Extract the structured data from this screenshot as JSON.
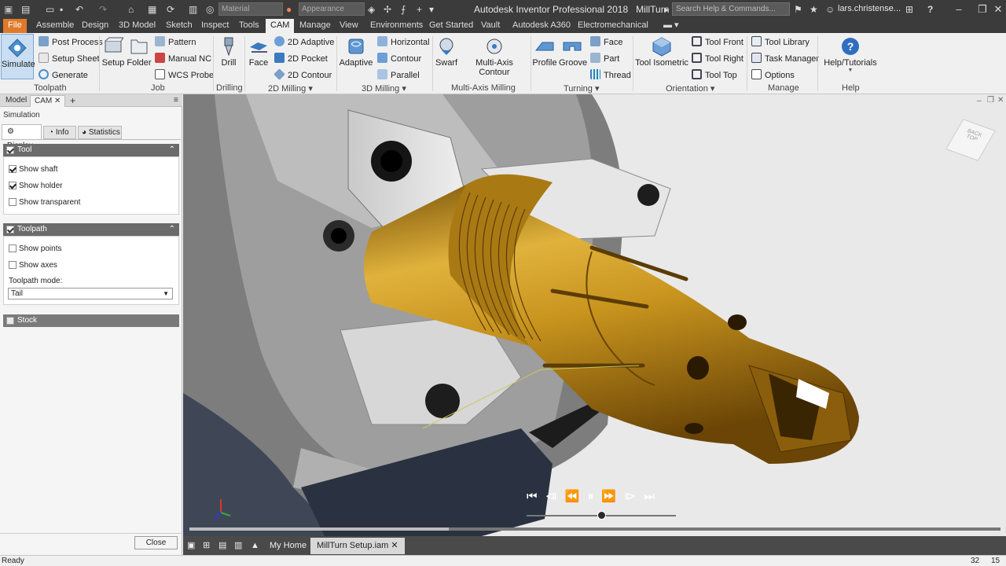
{
  "title_bar": {
    "app_title": "Autodesk Inventor Professional 2018",
    "document_name": "MillTurn Setup.iam",
    "material_dropdown": "Material",
    "appearance_dropdown": "Appearance",
    "search_placeholder": "Search Help & Commands...",
    "user_name": "lars.christense...",
    "help_label": "?"
  },
  "menu_tabs": [
    "File",
    "Assemble",
    "Design",
    "3D Model",
    "Sketch",
    "Inspect",
    "Tools",
    "CAM",
    "Manage",
    "View",
    "Environments",
    "Get Started",
    "Vault",
    "Autodesk A360",
    "Electromechanical"
  ],
  "active_tab": "CAM",
  "ribbon": {
    "toolpath": {
      "group": "Toolpath",
      "simulate": "Simulate",
      "post_process": "Post Process",
      "setup_sheet": "Setup Sheet",
      "generate": "Generate"
    },
    "job": {
      "group": "Job",
      "setup": "Setup",
      "folder": "Folder",
      "pattern": "Pattern",
      "manual_nc": "Manual NC",
      "wcs_probe": "WCS Probe"
    },
    "drilling": {
      "group": "Drilling",
      "drill": "Drill"
    },
    "milling_2d": {
      "group": "2D Milling",
      "face": "Face",
      "adaptive_2d": "2D Adaptive",
      "pocket_2d": "2D Pocket",
      "contour_2d": "2D Contour"
    },
    "milling_3d": {
      "group": "3D Milling",
      "adaptive": "Adaptive",
      "horizontal": "Horizontal",
      "contour": "Contour",
      "parallel": "Parallel"
    },
    "multi_axis": {
      "group": "Multi-Axis Milling",
      "swarf": "Swarf",
      "multi_axis_contour": "Multi-Axis Contour"
    },
    "turning": {
      "group": "Turning",
      "profile": "Profile",
      "groove": "Groove",
      "face": "Face",
      "part": "Part",
      "thread": "Thread"
    },
    "orientation": {
      "group": "Orientation",
      "tool_isometric": "Tool Isometric",
      "tool_front": "Tool Front",
      "tool_right": "Tool Right",
      "tool_top": "Tool Top"
    },
    "manage": {
      "group": "Manage",
      "tool_library": "Tool Library",
      "task_manager": "Task Manager",
      "options": "Options"
    },
    "help": {
      "group": "Help",
      "help_tutorials": "Help/Tutorials"
    }
  },
  "panel": {
    "tabs": [
      "Model",
      "CAM"
    ],
    "title": "Simulation",
    "subtabs": [
      "Display",
      "Info",
      "Statistics"
    ],
    "tool_section": {
      "title": "Tool",
      "show_shaft": "Show shaft",
      "show_holder": "Show holder",
      "show_transparent": "Show transparent",
      "shaft_checked": true,
      "holder_checked": true,
      "transparent_checked": false
    },
    "toolpath_section": {
      "title": "Toolpath",
      "show_points": "Show points",
      "show_axes": "Show axes",
      "mode_label": "Toolpath mode:",
      "mode_value": "Tail"
    },
    "stock_section": {
      "title": "Stock"
    },
    "close_label": "Close"
  },
  "view_cube": {
    "back": "BACK",
    "top": "TOP"
  },
  "doc_tabs": [
    "My Home",
    "MillTurn Setup.iam"
  ],
  "status": {
    "text": "Ready",
    "count_a": "32",
    "count_b": "15"
  },
  "playback": {
    "progress": 0.32,
    "speed": 0.5
  },
  "colors": {
    "accent": "#e0792a",
    "title_bg": "#3b3b3b",
    "part_gold": "#c8941e"
  }
}
